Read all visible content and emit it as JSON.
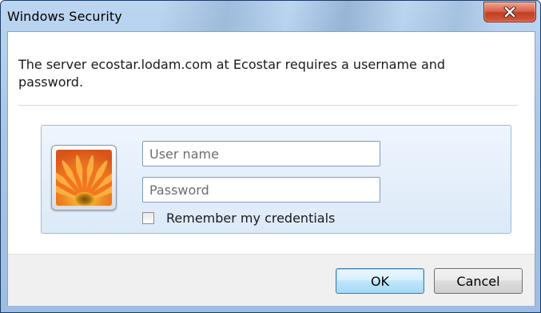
{
  "window": {
    "title": "Windows Security",
    "close_icon": "close-icon"
  },
  "dialog": {
    "message": "The server ecostar.lodam.com at Ecostar requires a username and password.",
    "avatar_icon": "user-tile-flower-icon"
  },
  "credentials": {
    "username_placeholder": "User name",
    "username_value": "",
    "password_placeholder": "Password",
    "password_value": "",
    "remember_label": "Remember my credentials",
    "remember_checked": false
  },
  "buttons": {
    "ok_label": "OK",
    "cancel_label": "Cancel"
  },
  "colors": {
    "title_glass": "#bcd6f1",
    "close_red": "#c23f22",
    "tile_bg": "#dce9f8",
    "footer_bg": "#f0f0f0",
    "default_button_border": "#3c7fb1"
  }
}
